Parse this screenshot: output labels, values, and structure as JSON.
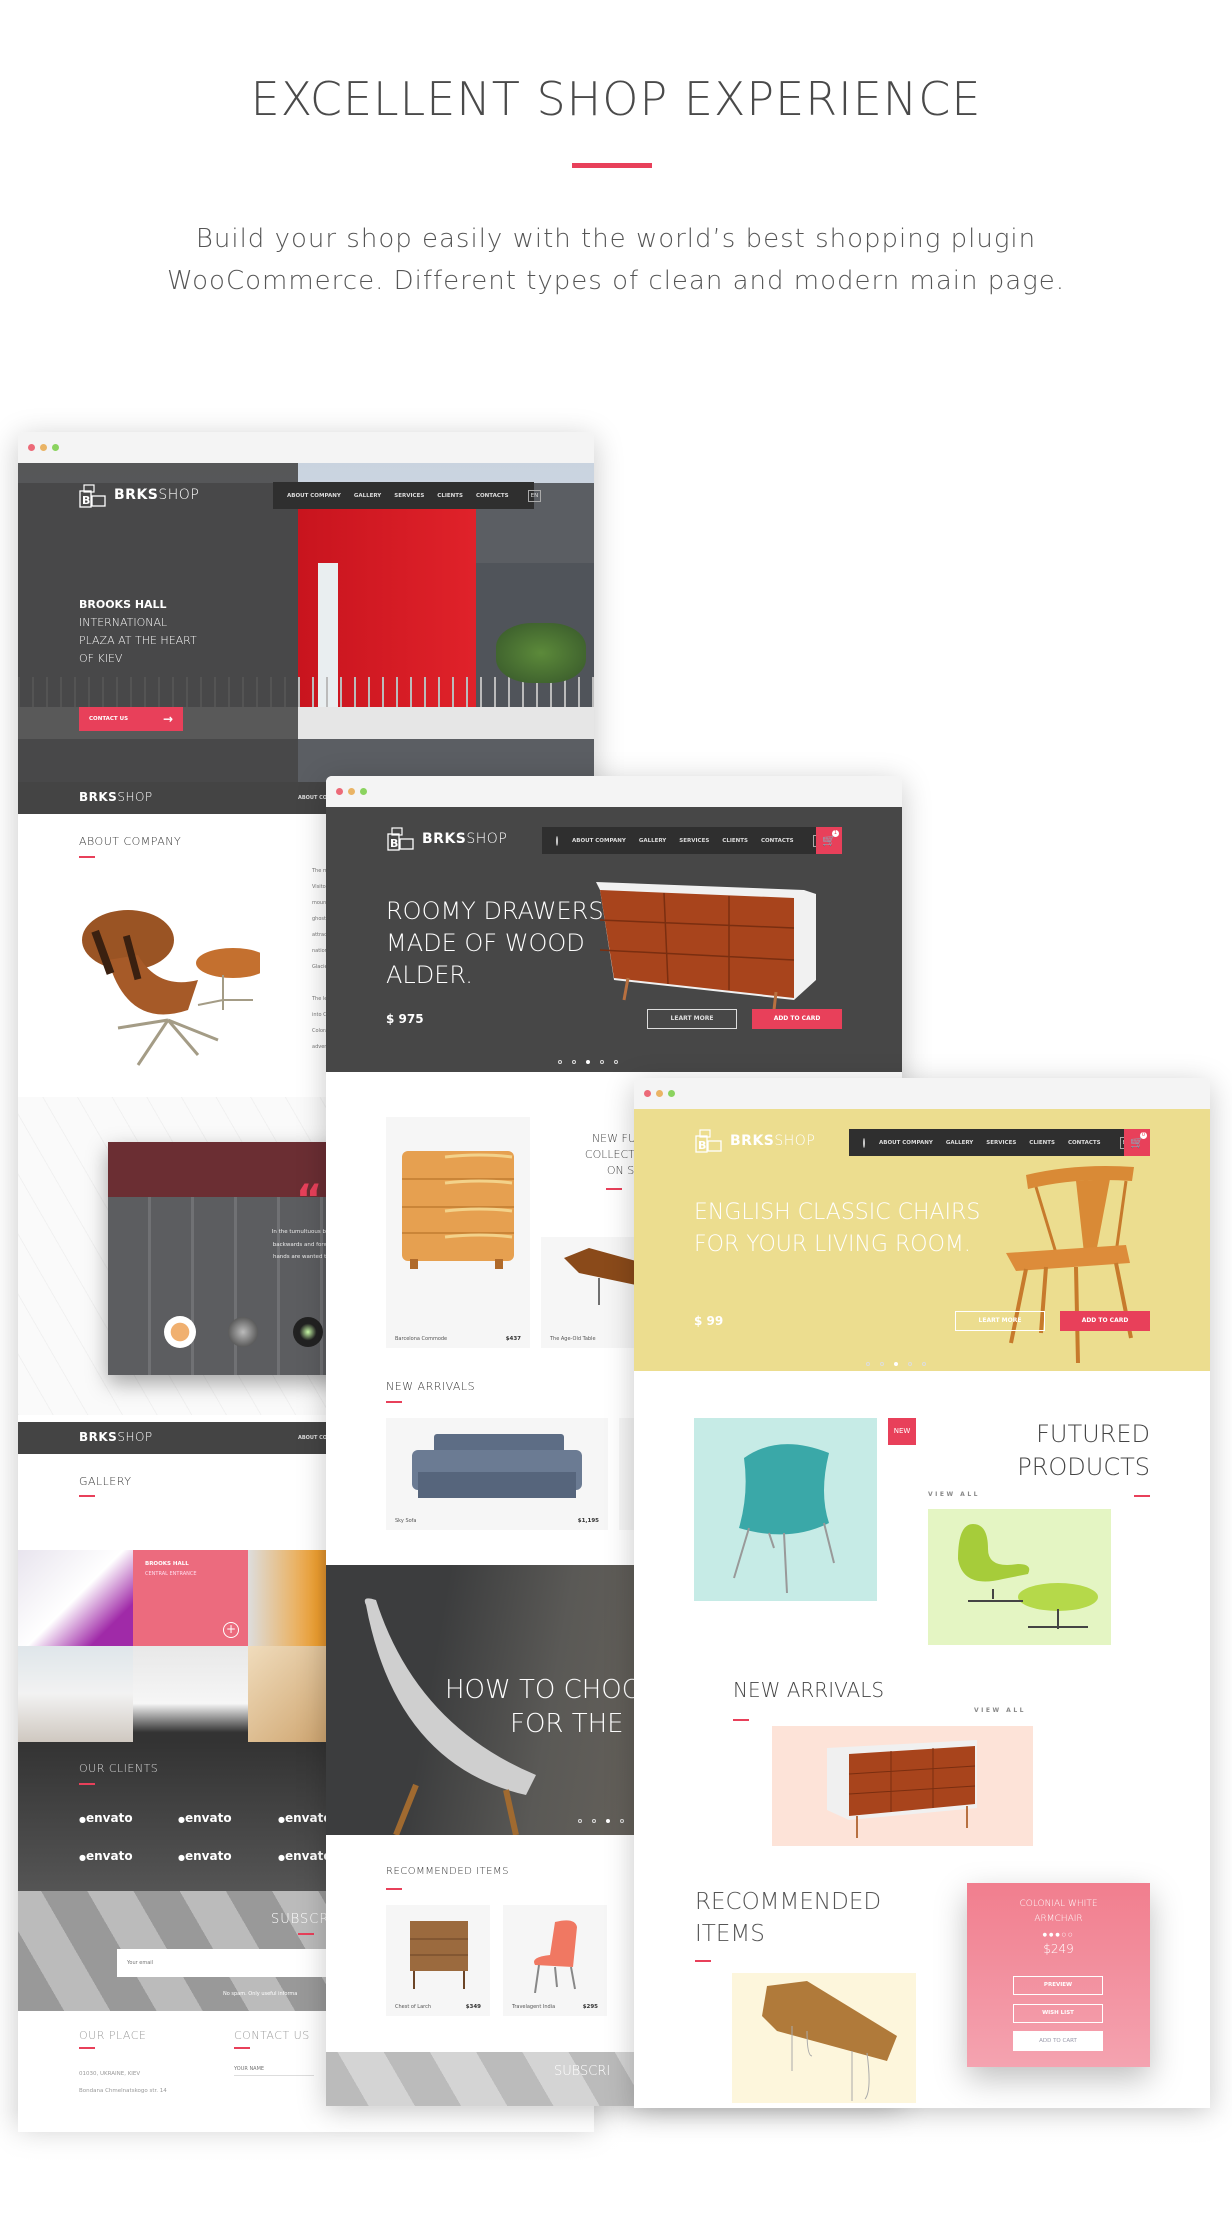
{
  "header": {
    "title": "EXCELLENT SHOP EXPERIENCE",
    "subtitle_lines": [
      "Build your shop easily with the world’s best shopping plugin",
      "WooCommerce. Different types of clean and modern main page."
    ]
  },
  "colors": {
    "accent": "#e8405a",
    "dark": "#444444",
    "yellow_hero": "#ecdd8f"
  },
  "brand": {
    "bold": "BRKS",
    "light": "SHOP"
  },
  "nav": {
    "items": [
      "ABOUT COMPANY",
      "GALLERY",
      "SERVICES",
      "CLIENTS",
      "CONTACTS"
    ],
    "lang": "EN"
  },
  "left": {
    "hero_lines": [
      "BROOKS HALL",
      "INTERNATIONAL",
      "PLAZA AT THE HEART",
      "OF KIEV"
    ],
    "contact_button": "CONTACT US",
    "subheader_nav": "ABOUT CO",
    "about_title": "ABOUT COMPANY",
    "about_text": [
      "The m",
      "Visitor",
      "moun",
      "ghost",
      "attrac",
      "nation",
      "Glacie",
      "",
      "The le",
      "into C",
      "Colora",
      "adven"
    ],
    "testimonial_lines": [
      "In the tumultuous business of cutting-in and atten",
      "backwards and forwards among the crew. Now ha",
      "hands are wanted there. There is no staying in an",
      "time everything has to be do"
    ],
    "testimonial_author": "Roy Peterse",
    "gallery_title": "GALLERY",
    "gallery_tile_title": "BROOKS HALL",
    "gallery_tile_sub": "CENTRAL ENTRANCE",
    "clients_title": "OUR CLIENTS",
    "client_logo": "envato",
    "subscribe_title": "SUBSCRI",
    "email_placeholder": "Your email",
    "subscribe_note": "No spam. Only useful informa",
    "footer": {
      "place_title": "OUR PLACE",
      "contact_title": "CONTACT US",
      "address": [
        "01030, UKRAINE, KIEV",
        "Bondana Chmelnatskogo str. 14"
      ],
      "name_placeholder": "YOUR NAME"
    }
  },
  "middle": {
    "cart_count": "1",
    "hero_lines": [
      "ROOMY DRAWERS",
      "MADE OF WOOD",
      "ALDER."
    ],
    "price": "$ 975",
    "learn_more": "LEART MORE",
    "add_to_card": "ADD TO CARD",
    "slider_active": 3,
    "collection_lines": [
      "NEW FURNI",
      "COLLECTION",
      "ON SALE"
    ],
    "products": [
      {
        "name": "Barcelona Commode",
        "price": "$437"
      },
      {
        "name": "The Age-Old Table",
        "price": ""
      }
    ],
    "new_arrivals_title": "NEW ARRIVALS",
    "arrivals": [
      {
        "name": "Sky Sofa",
        "price": "$1,195"
      }
    ],
    "blog_lines": [
      "HOW TO CHOOS",
      "FOR THE KI"
    ],
    "recommended_title": "RECOMMENDED ITEMS",
    "recommended": [
      {
        "name": "Chest of Larch",
        "price": "$349"
      },
      {
        "name": "Travelagent India",
        "price": "$295"
      }
    ],
    "bottom_subscribe": "SUBSCRI"
  },
  "right": {
    "cart_count": "0",
    "hero_lines": [
      "ENGLISH CLASSIC CHAIRS",
      "FOR YOUR LIVING ROOM."
    ],
    "price": "$ 99",
    "learn_more": "LEART MORE",
    "add_to_card": "ADD TO CARD",
    "slider_active": 3,
    "new_badge": "NEW",
    "featured_lines": [
      "FUTURED",
      "PRODUCTS"
    ],
    "view_all": "VIEW ALL",
    "new_arrivals_title": "NEW ARRIVALS",
    "recommended_lines": [
      "RECOMMENDED",
      "ITEMS"
    ],
    "promo": {
      "title_lines": [
        "COLONIAL WHITE",
        "ARMCHAIR"
      ],
      "rating": 3,
      "rating_max": 5,
      "price": "$249",
      "preview": "PREVIEW",
      "wish_list": "WISH LIST",
      "add_to_cart": "ADD TO CART"
    }
  }
}
